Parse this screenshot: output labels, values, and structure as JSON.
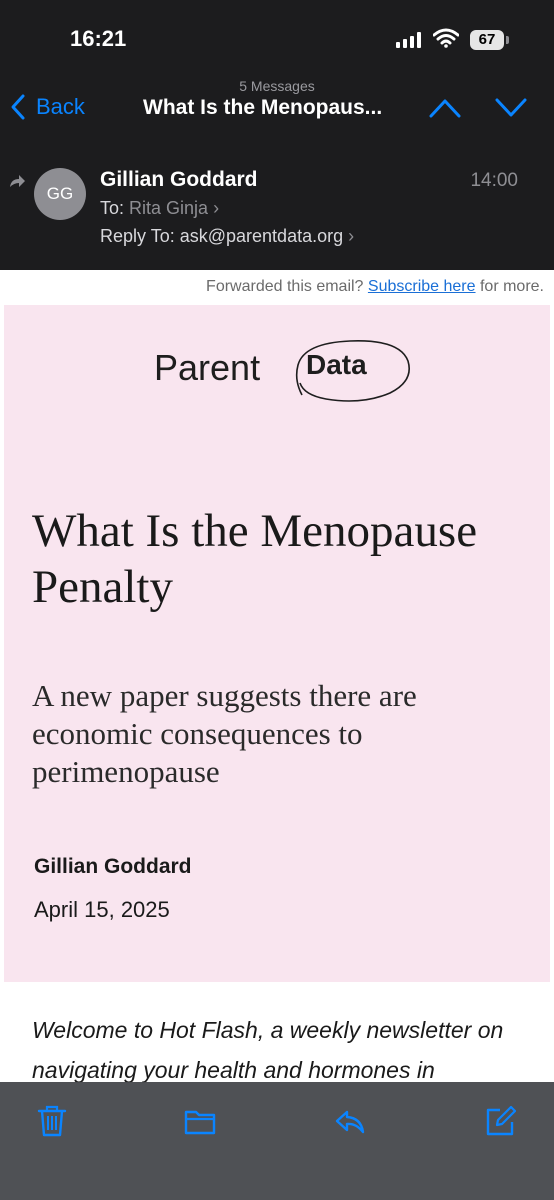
{
  "status_bar": {
    "time": "16:21",
    "battery": "67"
  },
  "nav": {
    "message_count": "5 Messages",
    "back_label": "Back",
    "title": "What Is the Menopaus..."
  },
  "sender": {
    "initials": "GG",
    "name": "Gillian Goddard",
    "time": "14:00",
    "to_label": "To:",
    "to_value": "Rita Ginja",
    "reply_label": "Reply To:",
    "reply_value": "ask@parentdata.org"
  },
  "email": {
    "forwarded_prefix": "Forwarded this email?",
    "subscribe_link": "Subscribe here",
    "forwarded_suffix": "for more.",
    "logo_word_1": "Parent",
    "logo_word_2": "Data",
    "headline": "What Is the Menopause Penalty",
    "subhead": "A new paper suggests there are economic consequences to perimenopause",
    "author": "Gillian Goddard",
    "date": "April 15, 2025",
    "intro": "Welcome to Hot Flash, a weekly newsletter on navigating your health and hormones in"
  },
  "colors": {
    "accent": "#0a84ff",
    "header_bg": "#1c1c1e",
    "card_bg": "#f9e5ef",
    "link": "#1a6fd6"
  },
  "icons": {
    "toolbar": [
      "trash-icon",
      "folder-icon",
      "reply-icon",
      "compose-icon"
    ]
  }
}
